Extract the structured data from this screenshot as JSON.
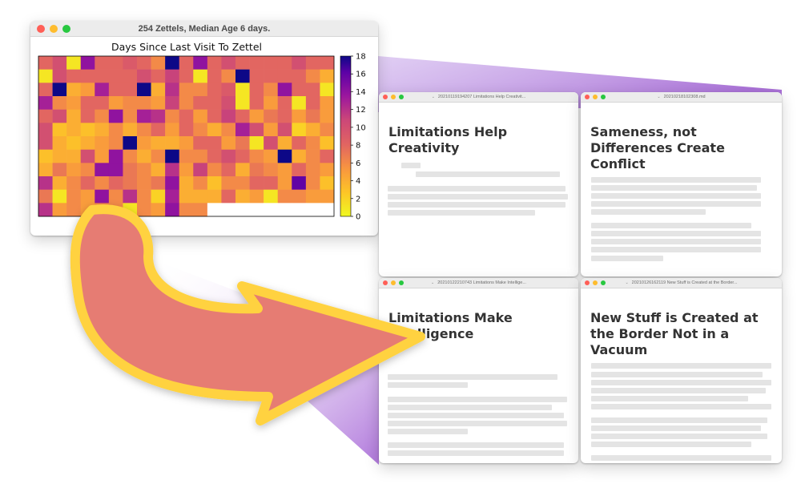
{
  "heatmap_window": {
    "title": "254 Zettels, Median Age 6 days."
  },
  "chart_data": {
    "type": "heatmap",
    "title": "Days Since Last Visit To Zettel",
    "xlabel": "",
    "ylabel": "",
    "colormap": "plasma (reversed): 0 = yellow, 18 = dark blue",
    "colorbar_ticks": [
      "0",
      "2",
      "4",
      "6",
      "8",
      "10",
      "12",
      "14",
      "16",
      "18"
    ],
    "value_range": [
      0,
      18
    ],
    "grid": false,
    "rows": [
      [
        8,
        10,
        1,
        14,
        8,
        8,
        9,
        8,
        6,
        18,
        8,
        14,
        8,
        10,
        8,
        8,
        8,
        8,
        10,
        8,
        8
      ],
      [
        1,
        10,
        8,
        8,
        8,
        8,
        8,
        10,
        8,
        11,
        8,
        1,
        8,
        6,
        18,
        8,
        8,
        8,
        8,
        6,
        4
      ],
      [
        8,
        18,
        4,
        5,
        13,
        8,
        8,
        18,
        4,
        12,
        6,
        6,
        8,
        9,
        1,
        8,
        6,
        14,
        8,
        8,
        1
      ],
      [
        13,
        6,
        5,
        8,
        8,
        5,
        6,
        6,
        5,
        11,
        6,
        8,
        8,
        10,
        1,
        8,
        5,
        8,
        1,
        8,
        5
      ],
      [
        8,
        10,
        4,
        8,
        6,
        14,
        6,
        13,
        12,
        6,
        8,
        5,
        8,
        11,
        8,
        5,
        7,
        8,
        5,
        7,
        5
      ],
      [
        10,
        3,
        4,
        3,
        4,
        6,
        4,
        6,
        8,
        5,
        8,
        6,
        4,
        6,
        13,
        10,
        5,
        10,
        2,
        4,
        6
      ],
      [
        10,
        4,
        3,
        4,
        5,
        6,
        18,
        5,
        4,
        4,
        5,
        8,
        8,
        5,
        7,
        1,
        10,
        4,
        8,
        6,
        3
      ],
      [
        3,
        4,
        4,
        10,
        5,
        14,
        6,
        4,
        6,
        18,
        6,
        6,
        8,
        10,
        8,
        6,
        5,
        18,
        4,
        6,
        8
      ],
      [
        4,
        7,
        5,
        6,
        14,
        14,
        7,
        6,
        4,
        12,
        5,
        11,
        6,
        8,
        4,
        7,
        6,
        5,
        8,
        6,
        5
      ],
      [
        12,
        4,
        6,
        8,
        6,
        8,
        7,
        6,
        7,
        14,
        4,
        6,
        3,
        6,
        6,
        8,
        8,
        5,
        16,
        6,
        3
      ],
      [
        7,
        1,
        6,
        5,
        14,
        6,
        12,
        6,
        2,
        13,
        4,
        4,
        4,
        8,
        4,
        5,
        1,
        6,
        6,
        5,
        5
      ],
      [
        12,
        5,
        6,
        5,
        6,
        6,
        1,
        6,
        5,
        14,
        6,
        6,
        null,
        null,
        null,
        null,
        null,
        null,
        null,
        null,
        null
      ]
    ]
  },
  "zettels": [
    {
      "title": "20210119194207 Limitations Help Creativit...",
      "heading": "Limitations Help Creativity"
    },
    {
      "title": "20210218102308.md",
      "heading": "Sameness, not Differences Create Conflict"
    },
    {
      "title": "20210122210743 Limitations Make Intellige...",
      "heading": "Limitations Make Intelligence"
    },
    {
      "title": "20210126162119 New Stuff is Created at the Border...",
      "heading": "New Stuff is Created at the Border Not in a Vacuum"
    }
  ],
  "colors": {
    "arrow_fill": "#e67c73",
    "arrow_stroke": "#ffd23f",
    "beam": "#9b59d0"
  }
}
